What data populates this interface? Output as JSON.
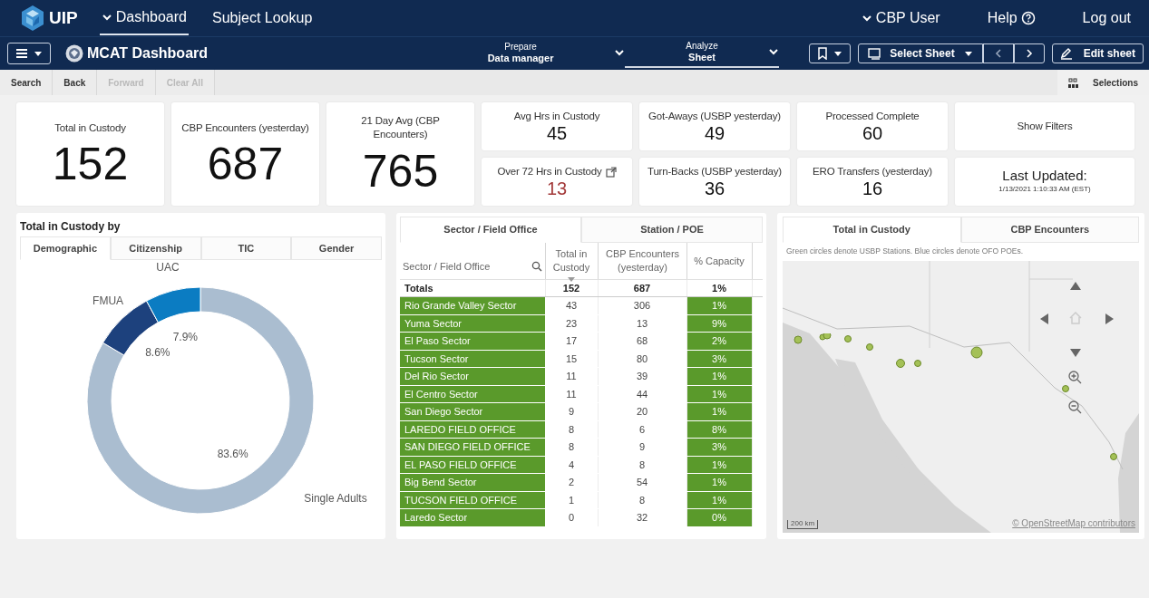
{
  "top_nav": {
    "logo": "UIP",
    "items": [
      {
        "label": "Dashboard",
        "selected": true,
        "dropdown": true
      },
      {
        "label": "Subject Lookup",
        "selected": false,
        "dropdown": false
      }
    ],
    "user": "CBP User",
    "help": "Help",
    "logout": "Log out"
  },
  "app_bar": {
    "title": "MCAT Dashboard",
    "modes": [
      {
        "label": "Prepare",
        "value": "Data manager",
        "selected": false
      },
      {
        "label": "Analyze",
        "value": "Sheet",
        "selected": true
      }
    ],
    "select_sheet": "Select Sheet",
    "edit": "Edit sheet"
  },
  "toolbar": {
    "buttons": [
      {
        "label": "Search",
        "disabled": false
      },
      {
        "label": "Back",
        "disabled": false
      },
      {
        "label": "Forward",
        "disabled": true
      },
      {
        "label": "Clear All",
        "disabled": true
      }
    ],
    "selections": "Selections"
  },
  "big_tiles": [
    {
      "label": "Total in Custody",
      "value": "152"
    },
    {
      "label": "CBP Encounters (yesterday)",
      "value": "687"
    },
    {
      "label": "21 Day Avg (CBP Encounters)",
      "value": "765"
    }
  ],
  "small_tiles": [
    {
      "label": "Avg Hrs in Custody",
      "value": "45",
      "alert": false,
      "link": false
    },
    {
      "label": "Got-Aways (USBP yesterday)",
      "value": "49",
      "alert": false,
      "link": false
    },
    {
      "label": "Processed Complete",
      "value": "60",
      "alert": false,
      "link": false
    },
    {
      "label": "Over 72 Hrs in Custody",
      "value": "13",
      "alert": true,
      "link": true
    },
    {
      "label": "Turn-Backs (USBP yesterday)",
      "value": "36",
      "alert": false,
      "link": false
    },
    {
      "label": "ERO Transfers (yesterday)",
      "value": "16",
      "alert": false,
      "link": false
    }
  ],
  "filters_button": "Show Filters",
  "last_updated": {
    "label": "Last Updated:",
    "value": "1/13/2021 1:10:33 AM (EST)"
  },
  "custody_panel": {
    "title": "Total in Custody by",
    "tabs": [
      {
        "label": "Demographic",
        "selected": true
      },
      {
        "label": "Citizenship",
        "selected": false
      },
      {
        "label": "TIC",
        "selected": false
      },
      {
        "label": "Gender",
        "selected": false
      }
    ],
    "chart_data": {
      "type": "donut",
      "categories": [
        "Single Adults",
        "FMUA",
        "UAC"
      ],
      "values": [
        83.6,
        8.6,
        7.9
      ],
      "value_labels": [
        "83.6%",
        "8.6%",
        "7.9%"
      ]
    }
  },
  "table_panel": {
    "tabs": [
      {
        "label": "Sector / Field Office",
        "selected": true
      },
      {
        "label": "Station / POE",
        "selected": false
      }
    ],
    "columns": [
      {
        "label": "Sector / Field Office",
        "sorted": false
      },
      {
        "label": "Total in Custody",
        "sorted": true
      },
      {
        "label": "CBP Encounters (yesterday)",
        "sorted": false
      },
      {
        "label": "% Capacity",
        "sorted": false
      }
    ],
    "totals": [
      "Totals",
      "152",
      "687",
      "1%"
    ],
    "rows": [
      [
        "Rio Grande Valley Sector",
        "43",
        "306",
        "1%"
      ],
      [
        "Yuma Sector",
        "23",
        "13",
        "9%"
      ],
      [
        "El Paso Sector",
        "17",
        "68",
        "2%"
      ],
      [
        "Tucson Sector",
        "15",
        "80",
        "3%"
      ],
      [
        "Del Rio Sector",
        "11",
        "39",
        "1%"
      ],
      [
        "El Centro Sector",
        "11",
        "44",
        "1%"
      ],
      [
        "San Diego Sector",
        "9",
        "20",
        "1%"
      ],
      [
        "LAREDO FIELD OFFICE",
        "8",
        "6",
        "8%"
      ],
      [
        "SAN DIEGO FIELD OFFICE",
        "8",
        "9",
        "3%"
      ],
      [
        "EL PASO FIELD OFFICE",
        "4",
        "8",
        "1%"
      ],
      [
        "Big Bend Sector",
        "2",
        "54",
        "1%"
      ],
      [
        "TUCSON FIELD OFFICE",
        "1",
        "8",
        "1%"
      ],
      [
        "Laredo Sector",
        "0",
        "32",
        "0%"
      ]
    ]
  },
  "map_panel": {
    "tabs": [
      {
        "label": "Total in Custody",
        "selected": true
      },
      {
        "label": "CBP Encounters",
        "selected": false
      }
    ],
    "note": "Green circles denote USBP Stations. Blue circles denote OFO POEs.",
    "scale": "200 km",
    "attribution": "© OpenStreetMap contributors"
  }
}
